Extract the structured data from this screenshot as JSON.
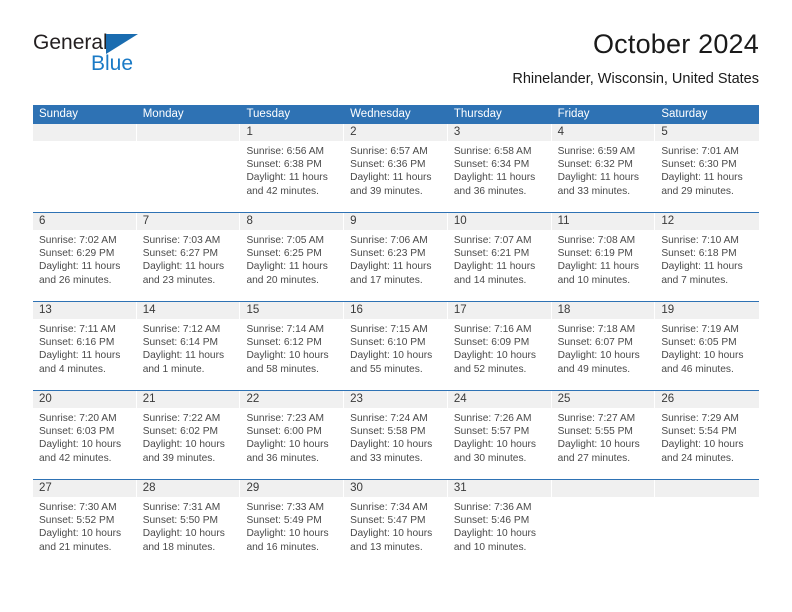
{
  "brand": {
    "name_part1": "General",
    "name_part2": "Blue",
    "triangle_icon": "triangle-logo-icon",
    "color_dark": "#231f20",
    "color_blue": "#1a7ac6"
  },
  "header": {
    "title": "October 2024",
    "subtitle": "Rhinelander, Wisconsin, United States"
  },
  "theme": {
    "header_blue": "#2e72b4",
    "day_band_gray": "#f0f0f0",
    "text_gray": "#4a4a4a"
  },
  "weekdays": [
    "Sunday",
    "Monday",
    "Tuesday",
    "Wednesday",
    "Thursday",
    "Friday",
    "Saturday"
  ],
  "weeks": [
    [
      {
        "day": "",
        "sunrise": "",
        "sunset": "",
        "daylight": "",
        "empty": true
      },
      {
        "day": "",
        "sunrise": "",
        "sunset": "",
        "daylight": "",
        "empty": true
      },
      {
        "day": "1",
        "sunrise": "Sunrise: 6:56 AM",
        "sunset": "Sunset: 6:38 PM",
        "daylight": "Daylight: 11 hours and 42 minutes."
      },
      {
        "day": "2",
        "sunrise": "Sunrise: 6:57 AM",
        "sunset": "Sunset: 6:36 PM",
        "daylight": "Daylight: 11 hours and 39 minutes."
      },
      {
        "day": "3",
        "sunrise": "Sunrise: 6:58 AM",
        "sunset": "Sunset: 6:34 PM",
        "daylight": "Daylight: 11 hours and 36 minutes."
      },
      {
        "day": "4",
        "sunrise": "Sunrise: 6:59 AM",
        "sunset": "Sunset: 6:32 PM",
        "daylight": "Daylight: 11 hours and 33 minutes."
      },
      {
        "day": "5",
        "sunrise": "Sunrise: 7:01 AM",
        "sunset": "Sunset: 6:30 PM",
        "daylight": "Daylight: 11 hours and 29 minutes."
      }
    ],
    [
      {
        "day": "6",
        "sunrise": "Sunrise: 7:02 AM",
        "sunset": "Sunset: 6:29 PM",
        "daylight": "Daylight: 11 hours and 26 minutes."
      },
      {
        "day": "7",
        "sunrise": "Sunrise: 7:03 AM",
        "sunset": "Sunset: 6:27 PM",
        "daylight": "Daylight: 11 hours and 23 minutes."
      },
      {
        "day": "8",
        "sunrise": "Sunrise: 7:05 AM",
        "sunset": "Sunset: 6:25 PM",
        "daylight": "Daylight: 11 hours and 20 minutes."
      },
      {
        "day": "9",
        "sunrise": "Sunrise: 7:06 AM",
        "sunset": "Sunset: 6:23 PM",
        "daylight": "Daylight: 11 hours and 17 minutes."
      },
      {
        "day": "10",
        "sunrise": "Sunrise: 7:07 AM",
        "sunset": "Sunset: 6:21 PM",
        "daylight": "Daylight: 11 hours and 14 minutes."
      },
      {
        "day": "11",
        "sunrise": "Sunrise: 7:08 AM",
        "sunset": "Sunset: 6:19 PM",
        "daylight": "Daylight: 11 hours and 10 minutes."
      },
      {
        "day": "12",
        "sunrise": "Sunrise: 7:10 AM",
        "sunset": "Sunset: 6:18 PM",
        "daylight": "Daylight: 11 hours and 7 minutes."
      }
    ],
    [
      {
        "day": "13",
        "sunrise": "Sunrise: 7:11 AM",
        "sunset": "Sunset: 6:16 PM",
        "daylight": "Daylight: 11 hours and 4 minutes."
      },
      {
        "day": "14",
        "sunrise": "Sunrise: 7:12 AM",
        "sunset": "Sunset: 6:14 PM",
        "daylight": "Daylight: 11 hours and 1 minute."
      },
      {
        "day": "15",
        "sunrise": "Sunrise: 7:14 AM",
        "sunset": "Sunset: 6:12 PM",
        "daylight": "Daylight: 10 hours and 58 minutes."
      },
      {
        "day": "16",
        "sunrise": "Sunrise: 7:15 AM",
        "sunset": "Sunset: 6:10 PM",
        "daylight": "Daylight: 10 hours and 55 minutes."
      },
      {
        "day": "17",
        "sunrise": "Sunrise: 7:16 AM",
        "sunset": "Sunset: 6:09 PM",
        "daylight": "Daylight: 10 hours and 52 minutes."
      },
      {
        "day": "18",
        "sunrise": "Sunrise: 7:18 AM",
        "sunset": "Sunset: 6:07 PM",
        "daylight": "Daylight: 10 hours and 49 minutes."
      },
      {
        "day": "19",
        "sunrise": "Sunrise: 7:19 AM",
        "sunset": "Sunset: 6:05 PM",
        "daylight": "Daylight: 10 hours and 46 minutes."
      }
    ],
    [
      {
        "day": "20",
        "sunrise": "Sunrise: 7:20 AM",
        "sunset": "Sunset: 6:03 PM",
        "daylight": "Daylight: 10 hours and 42 minutes."
      },
      {
        "day": "21",
        "sunrise": "Sunrise: 7:22 AM",
        "sunset": "Sunset: 6:02 PM",
        "daylight": "Daylight: 10 hours and 39 minutes."
      },
      {
        "day": "22",
        "sunrise": "Sunrise: 7:23 AM",
        "sunset": "Sunset: 6:00 PM",
        "daylight": "Daylight: 10 hours and 36 minutes."
      },
      {
        "day": "23",
        "sunrise": "Sunrise: 7:24 AM",
        "sunset": "Sunset: 5:58 PM",
        "daylight": "Daylight: 10 hours and 33 minutes."
      },
      {
        "day": "24",
        "sunrise": "Sunrise: 7:26 AM",
        "sunset": "Sunset: 5:57 PM",
        "daylight": "Daylight: 10 hours and 30 minutes."
      },
      {
        "day": "25",
        "sunrise": "Sunrise: 7:27 AM",
        "sunset": "Sunset: 5:55 PM",
        "daylight": "Daylight: 10 hours and 27 minutes."
      },
      {
        "day": "26",
        "sunrise": "Sunrise: 7:29 AM",
        "sunset": "Sunset: 5:54 PM",
        "daylight": "Daylight: 10 hours and 24 minutes."
      }
    ],
    [
      {
        "day": "27",
        "sunrise": "Sunrise: 7:30 AM",
        "sunset": "Sunset: 5:52 PM",
        "daylight": "Daylight: 10 hours and 21 minutes."
      },
      {
        "day": "28",
        "sunrise": "Sunrise: 7:31 AM",
        "sunset": "Sunset: 5:50 PM",
        "daylight": "Daylight: 10 hours and 18 minutes."
      },
      {
        "day": "29",
        "sunrise": "Sunrise: 7:33 AM",
        "sunset": "Sunset: 5:49 PM",
        "daylight": "Daylight: 10 hours and 16 minutes."
      },
      {
        "day": "30",
        "sunrise": "Sunrise: 7:34 AM",
        "sunset": "Sunset: 5:47 PM",
        "daylight": "Daylight: 10 hours and 13 minutes."
      },
      {
        "day": "31",
        "sunrise": "Sunrise: 7:36 AM",
        "sunset": "Sunset: 5:46 PM",
        "daylight": "Daylight: 10 hours and 10 minutes."
      },
      {
        "day": "",
        "sunrise": "",
        "sunset": "",
        "daylight": "",
        "empty": true
      },
      {
        "day": "",
        "sunrise": "",
        "sunset": "",
        "daylight": "",
        "empty": true
      }
    ]
  ]
}
